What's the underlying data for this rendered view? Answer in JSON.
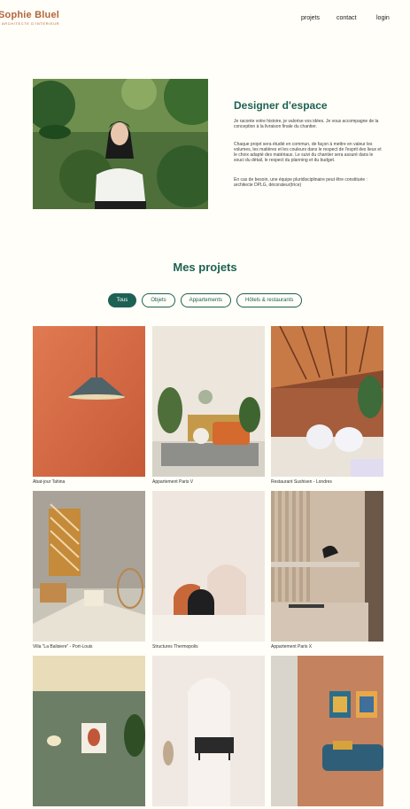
{
  "brand": {
    "name": "Sophie Bluel",
    "subtitle": "ARCHITECTE D'INTERIEUR"
  },
  "nav": {
    "projects": "projets",
    "contact": "contact",
    "login": "login"
  },
  "intro": {
    "title": "Designer d'espace",
    "paragraphs": [
      "Je raconte votre histoire, je valorise vos idées. Je vous accompagne de la conception à la livraison finale du chantier.",
      "Chaque projet sera étudié en commun, de façon à mettre en valeur les volumes, les matières et les couleurs dans le respect de l'esprit des lieux et le choix adapté des matériaux. Le suivi du chantier sera assuré dans le souci du détail, le respect du planning et du budget.",
      "En cas de besoin, une équipe pluridisciplinaire peut être constituée : architecte DPLG, décorateur(trice)"
    ]
  },
  "portfolio": {
    "title": "Mes projets",
    "filters": [
      "Tous",
      "Objets",
      "Appartements",
      "Hôtels & restaurants"
    ],
    "active_filter": "Tous",
    "projects": [
      {
        "title": "Abat-jour Tahina"
      },
      {
        "title": "Appartement Paris V"
      },
      {
        "title": "Restaurant Sushisen - Londres"
      },
      {
        "title": "Villa “La Balisiere” - Port-Louis"
      },
      {
        "title": "Structures Thermopolis"
      },
      {
        "title": "Appartement Paris X"
      },
      {
        "title": ""
      },
      {
        "title": ""
      },
      {
        "title": ""
      }
    ]
  },
  "colors": {
    "primary": "#1D6154",
    "brand": "#B1663C",
    "background": "#FFFEF8"
  }
}
